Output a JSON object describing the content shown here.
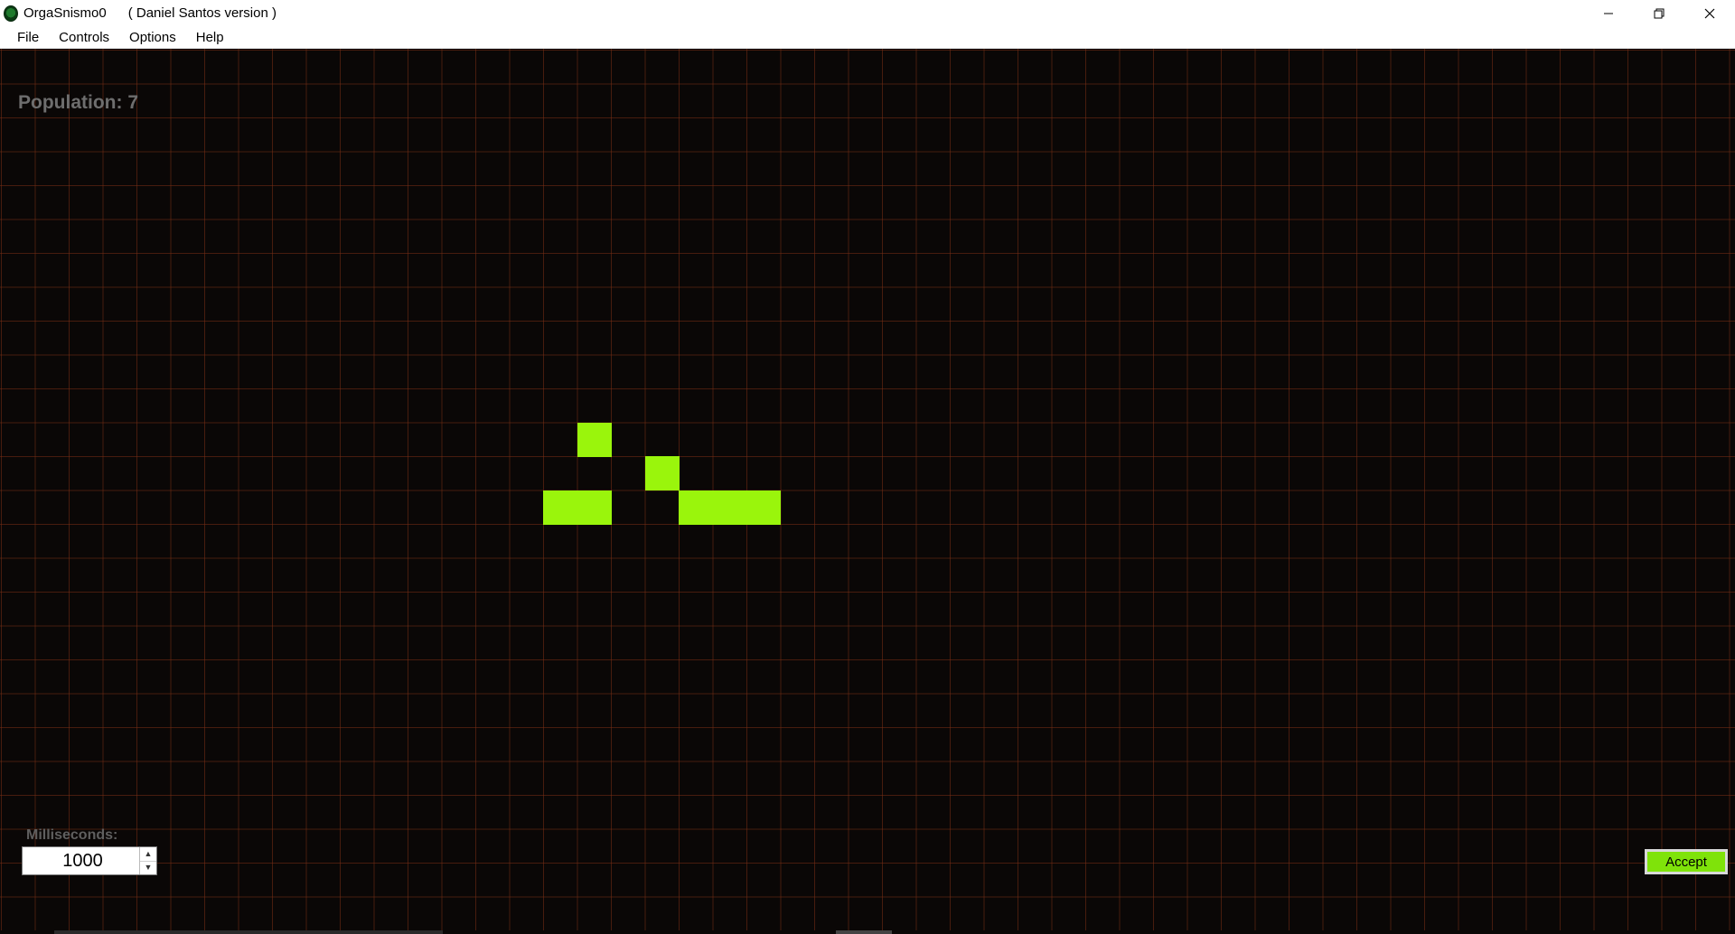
{
  "window": {
    "title": "OrgaSnismo0",
    "subtitle": "( Daniel Santos version )",
    "app_icon": "green-orb-icon",
    "controls": [
      "minimize-icon",
      "restore-icon",
      "close-icon"
    ]
  },
  "menu": {
    "file": "File",
    "controls": "Controls",
    "options": "Options",
    "help": "Help"
  },
  "status": {
    "population": "Population: 7"
  },
  "grid": {
    "line_color": "#782e14",
    "cell_color": "#9af50c",
    "background": "#0a0706",
    "live_cells": [
      {
        "col": 17,
        "row": 11
      },
      {
        "col": 19,
        "row": 12
      },
      {
        "col": 16,
        "row": 13
      },
      {
        "col": 17,
        "row": 13
      },
      {
        "col": 20,
        "row": 13
      },
      {
        "col": 21,
        "row": 13
      },
      {
        "col": 22,
        "row": 13
      }
    ]
  },
  "speed": {
    "label": "Milliseconds:",
    "value": "1000"
  },
  "accept": {
    "label": "Accept",
    "color": "#7fe30a"
  }
}
